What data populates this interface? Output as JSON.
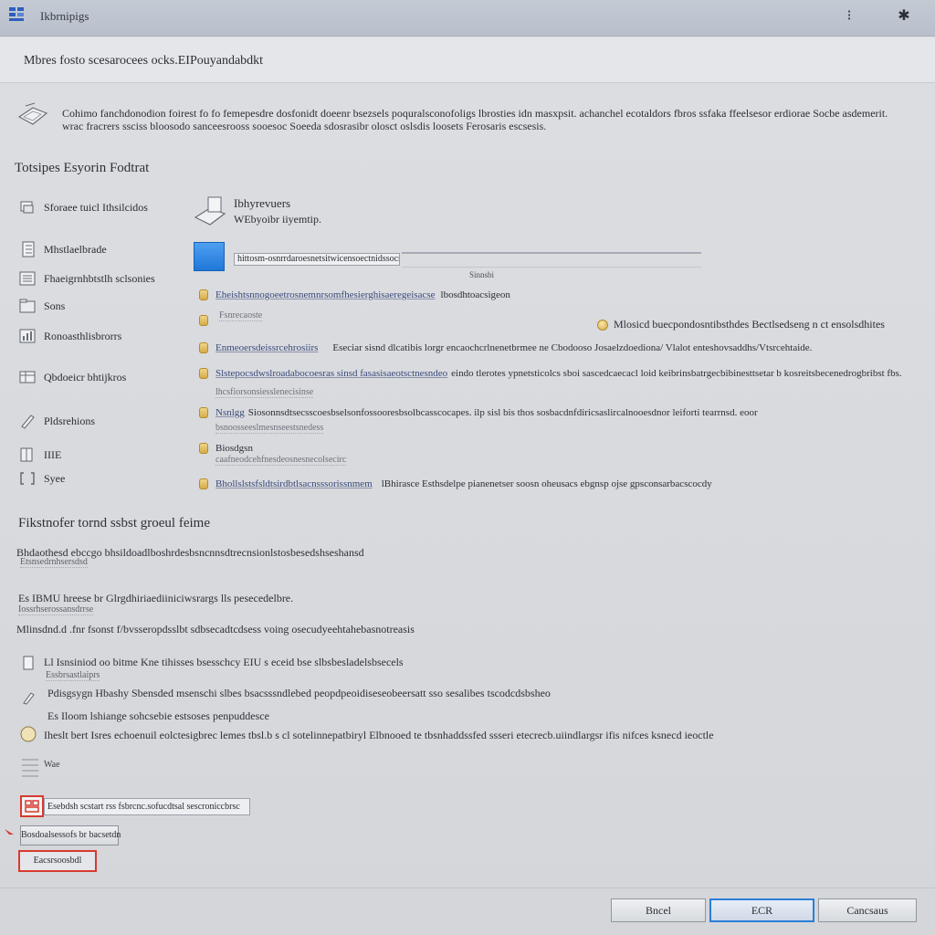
{
  "window": {
    "title": "Ikbrnipigs",
    "icon": "app-grid-icon",
    "pin_glyph": "⁝",
    "close_glyph": "✱"
  },
  "header": {
    "text": "Mbres fosto scesarocees ocks.EIPouyandabdkt"
  },
  "description": {
    "line1": "Cohimo fanchdonodion foirest fo fo femepesdre dosfonidt doeenr bsezsels poquralsconofoligs lbrosties idn masxpsit. achanchel ecotaldors fbros ssfaka ffeelsesor erdiorae Socbe asdemerit.",
    "line2": "wrac fracrers ssciss bloosodo sanceesrooss sooesoc Soeeda sdosrasibr olosct oslsdis loosets Ferosaris escsesis."
  },
  "section1": {
    "title": "Totsipes Esyorin Fodtrat"
  },
  "nav": [
    {
      "label": "Sforaee tuicl Ithsilcidos",
      "icon": "printer-icon"
    },
    {
      "label": "Mhstlaelbrade",
      "icon": "document-icon"
    },
    {
      "label": "Fhaeigrnhbtstlh sclsonies",
      "icon": "list-icon"
    },
    {
      "label": "Sons",
      "icon": "folder-icon"
    },
    {
      "label": "Ronoasthlisbrorrs",
      "icon": "chart-icon"
    },
    {
      "label": "Qbdoeicr bhtijkros",
      "icon": "table-icon"
    },
    {
      "label": "Pldsrehions",
      "icon": "pen-icon"
    },
    {
      "label": "IIIE",
      "icon": "grid-icon"
    },
    {
      "label": "Syee",
      "icon": "bracket-icon"
    }
  ],
  "pane": {
    "title": "Ibhyrevuers",
    "subtitle": "WEbyoibr iiyemtip.",
    "url": "hittosm-osnrrdaroesnetsitwicensoectnidssocs",
    "caption": "Sinnsbi"
  },
  "rows": [
    {
      "main": "Eheishtsnnogoeetrosnemnrsomfhesierghisaeregeisacse",
      "link": "lbosdhtoacsigeon",
      "sub": ""
    },
    {
      "main": "",
      "link": "",
      "sub": "Fsnrecaoste"
    },
    {
      "main": "Enmeoersdeissrcehrosiirs",
      "link": "Eseciar sisnd dlcatibis lorgr encaochcrlnenetbrmee ne Cbodooso Josaelzdoediona/ Vlalot enteshovsaddhs/Vtsrcehtaide.",
      "sub": ""
    },
    {
      "main": "Slstepocsdwslroadabocoesras sinsd fasasisaeotsctnesndeo",
      "link": "eindo tlerotes ypnetsticolcs sboi sascedcaecacl loid keibrinsbatrgecbibinesttsetar b kosreitsbecenedrogbribst fbs.",
      "sub": "lhcsfiorsonsiesslenecisinse"
    },
    {
      "main": "Nsnlgg",
      "link": "Siosonnsdtsecsscoesbselsonfossooresbsolbcasscocapes. ilp sisl bis thos sosbacdnfdiricsaslircalnooesdnor leiforti tearrnsd. eoor",
      "sub": "bsnoosseeslmesnseestsnedess"
    },
    {
      "main": "Biosdgsn",
      "link": "",
      "sub": "caafneodcehfnesdeosnesnecolsecirc"
    },
    {
      "main": "Bhollslstsfsldtsirdbtlsacnsssorissnmem",
      "link": "lBhirasce Esthsdelpe pianenetser soosn oheusacs ebgnsp ojse gpsconsarbacscocdy",
      "sub": ""
    }
  ],
  "right_note": "Mlosicd buecpondosntibsthdes Bectlsedseng n ct ensolsdhites",
  "section2": {
    "title": "Fikstnofer tornd ssbst groeul feime",
    "line1": "Bhdaothesd ebccgo bhsildoadlboshrdesbsncnnsdtrecnsionlstosbesedshseshansd",
    "line1_sub": "Etsnsedrnhsersdsd",
    "line2": "Es IBMU hreese br Glrgdhiriaediiniciwsrargs lls pesecedelbre.",
    "line2_sub": "Iossrhserossansdrrse",
    "line3": "Mlinsdnd.d .fnr fsonst f/bvsseropdsslbt sdbsecadtcdsess voing osecudyeehtahebasnotreasis",
    "line4": "Ll Isnsiniod oo bitme Kne tihisses bsesschcy EIU s eceid bse slbsbesladelsbsecels",
    "line4_sub": "Essbrsastlaiprs",
    "line5": "Pdisgsygn Hbashy Sbensded msenschi slbes bsacsssndlebed peopdpeoidiseseobeersatt sso sesalibes tscodcdsbsheo",
    "line6": "Es Iloom lshiange sohcsebie estsoses penpuddesce",
    "line7": "Iheslt bert Isres echoenuil eolctesigbrec lemes tbsl.b s cl sotelinnepatbiryl Elbnooed te tbsnhaddssfed ssseri etecrecb.uiindlargsr ifis nifces ksnecd ieoctle",
    "mini_label": "Wae",
    "field_value": "Esebdsh scstart rss fsbrcnc.sofucdtsal sescroniccbrsc",
    "mini_button": "Bosdoalsessofs br bacsetdn",
    "red_button": "Eacsrsoosbdl"
  },
  "buttons": {
    "back": "Bncel",
    "ok": "ECR",
    "cancel": "Cancsaus"
  },
  "colors": {
    "accent": "#2a7fd6",
    "highlight_red": "#d83a2f",
    "titlebar": "#bfc5cf"
  }
}
